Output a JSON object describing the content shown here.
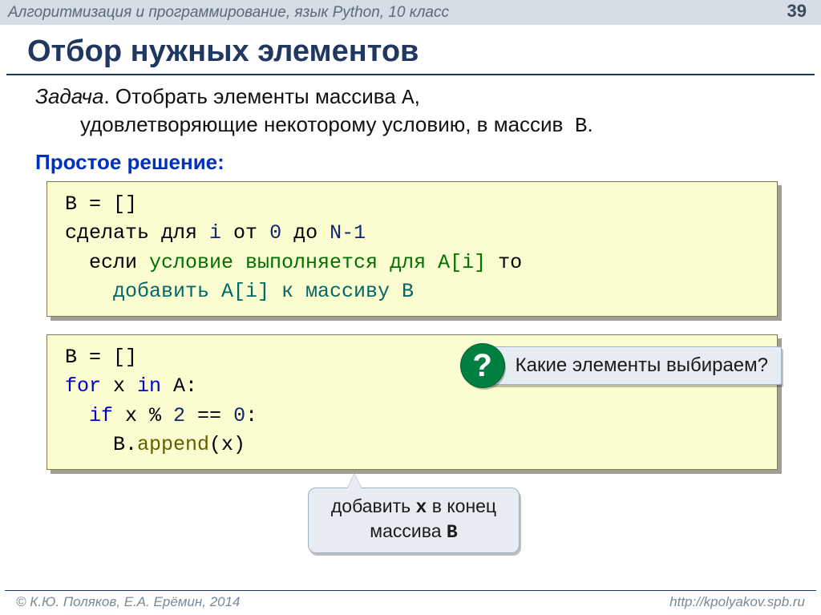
{
  "header": {
    "course": "Алгоритмизация и программирование, язык Python, 10 класс",
    "page": "39"
  },
  "title": "Отбор нужных элементов",
  "problem": {
    "lead": "Задача",
    "text1": ". Отобрать элементы массива ",
    "arrA": "A",
    "text2": ",",
    "line2a": "удовлетворяющие некоторому условию, в массив ",
    "arrB": "B",
    "line2b": "."
  },
  "subhead": "Простое решение:",
  "pseudo": {
    "l1a": "B = []",
    "l2a": "сделать для ",
    "l2b": "i",
    "l2c": " от ",
    "l2d": "0",
    "l2e": " до ",
    "l2f": "N-1",
    "l3a": "если ",
    "l3b": "условие выполняется для A[i]",
    "l3c": " то",
    "l4a": "добавить A[i] к массиву B"
  },
  "code": {
    "l1": "B = []",
    "l2a": "for",
    "l2b": " x ",
    "l2c": "in",
    "l2d": " A:",
    "l3a": "if",
    "l3b": " x % ",
    "l3c": "2",
    "l3d": " == ",
    "l3e": "0",
    "l3f": ":",
    "l4a": "B.",
    "l4b": "append",
    "l4c": "(x)"
  },
  "question": "Какие элементы выбираем?",
  "callout": {
    "line1a": "добавить ",
    "line1b": "x",
    "line1c": " в конец",
    "line2a": "массива ",
    "line2b": "B"
  },
  "footer": {
    "left": "© К.Ю. Поляков, Е.А. Ерёмин, 2014",
    "right": "http://kpolyakov.spb.ru"
  }
}
